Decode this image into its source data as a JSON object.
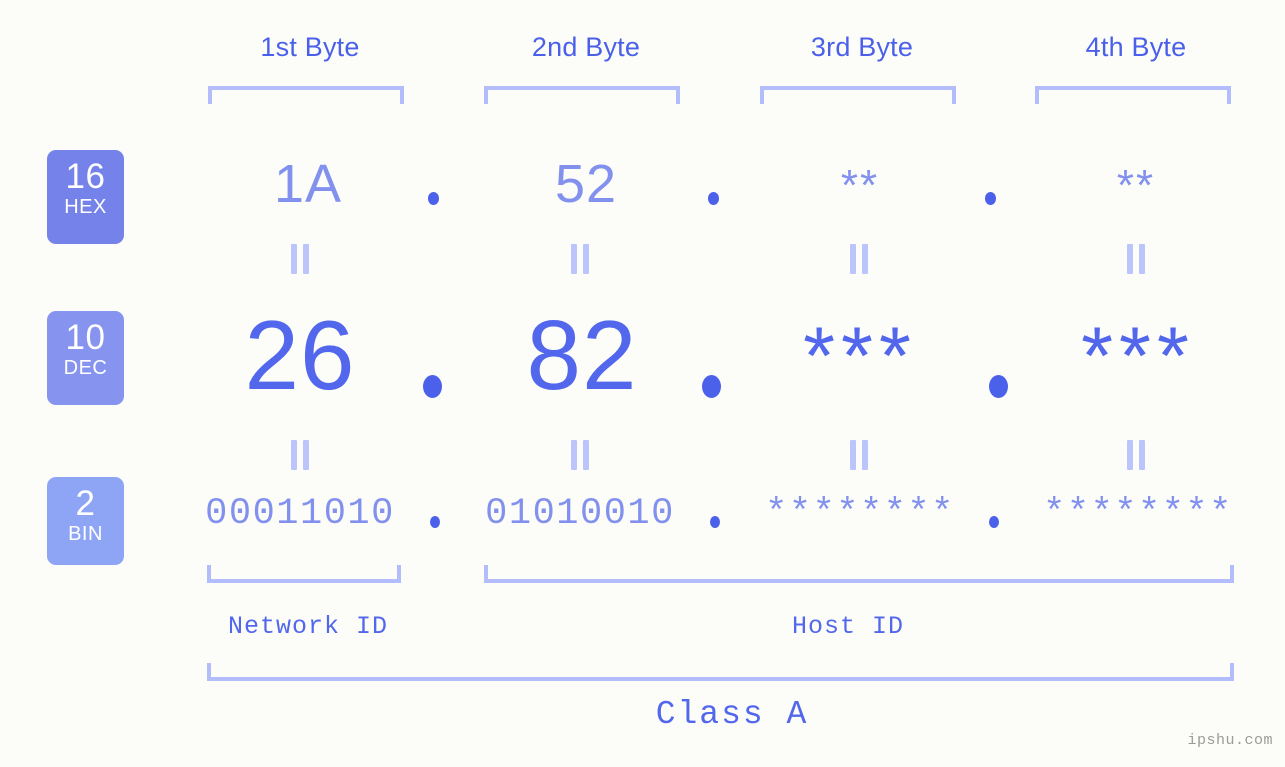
{
  "header": {
    "byte_labels": [
      {
        "label": "1st Byte"
      },
      {
        "label": "2nd Byte"
      },
      {
        "label": "3rd Byte"
      },
      {
        "label": "4th Byte"
      }
    ]
  },
  "bases": [
    {
      "radix": "16",
      "name": "HEX",
      "color": "#7482e9"
    },
    {
      "radix": "10",
      "name": "DEC",
      "color": "#8694f0"
    },
    {
      "radix": "2",
      "name": "BIN",
      "color": "#8ea5f5"
    }
  ],
  "rows": {
    "hex": {
      "octets": [
        "1A",
        "52",
        "**",
        "**"
      ],
      "separator": "."
    },
    "dec": {
      "octets": [
        "26",
        "82",
        "***",
        "***"
      ],
      "separator": "."
    },
    "bin": {
      "octets": [
        "00011010",
        "01010010",
        "********",
        "********"
      ],
      "separator": "."
    }
  },
  "equals_symbol": "=",
  "footer": {
    "network_id": "Network ID",
    "host_id": "Host ID",
    "class": "Class A"
  },
  "watermark": "ipshu.com",
  "colors": {
    "background": "#fcfdf8",
    "accent_dark": "#4c61ea",
    "accent_mid": "#5267ec",
    "accent_light": "#8391ee",
    "bracket": "#b3bdfb"
  }
}
